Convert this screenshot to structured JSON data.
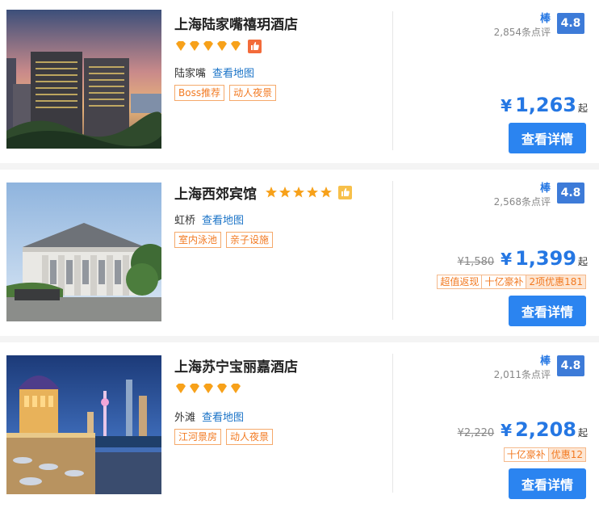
{
  "hotels": [
    {
      "name": "上海陆家嘴禧玥酒店",
      "star_count": 5,
      "star_style": "diamond",
      "badge": "thumbs-up",
      "badge_color": "#f36b3a",
      "district": "陆家嘴",
      "map_link": "查看地图",
      "tags": [
        "Boss推荐",
        "动人夜景"
      ],
      "rating_word": "棒",
      "reviews": "2,854条点评",
      "score": "4.8",
      "original_price": "",
      "currency": "¥",
      "price": "1,263",
      "price_suffix": "起",
      "promos": [],
      "button": "查看详情"
    },
    {
      "name": "上海西郊宾馆",
      "star_count": 5,
      "star_style": "star",
      "badge": "thumbs-up",
      "badge_color": "#f7c04a",
      "district": "虹桥",
      "map_link": "查看地图",
      "tags": [
        "室内泳池",
        "亲子设施"
      ],
      "rating_word": "棒",
      "reviews": "2,568条点评",
      "score": "4.8",
      "original_price": "¥1,580",
      "currency": "¥",
      "price": "1,399",
      "price_suffix": "起",
      "promos": [
        "超值返现",
        "十亿豪补",
        "2项优惠181"
      ],
      "button": "查看详情"
    },
    {
      "name": "上海苏宁宝丽嘉酒店",
      "star_count": 5,
      "star_style": "diamond",
      "badge": "",
      "district": "外滩",
      "map_link": "查看地图",
      "tags": [
        "江河景房",
        "动人夜景"
      ],
      "rating_word": "棒",
      "reviews": "2,011条点评",
      "score": "4.8",
      "original_price": "¥2,220",
      "currency": "¥",
      "price": "2,208",
      "price_suffix": "起",
      "promos": [
        "十亿豪补",
        "优惠12"
      ],
      "button": "查看详情"
    }
  ]
}
